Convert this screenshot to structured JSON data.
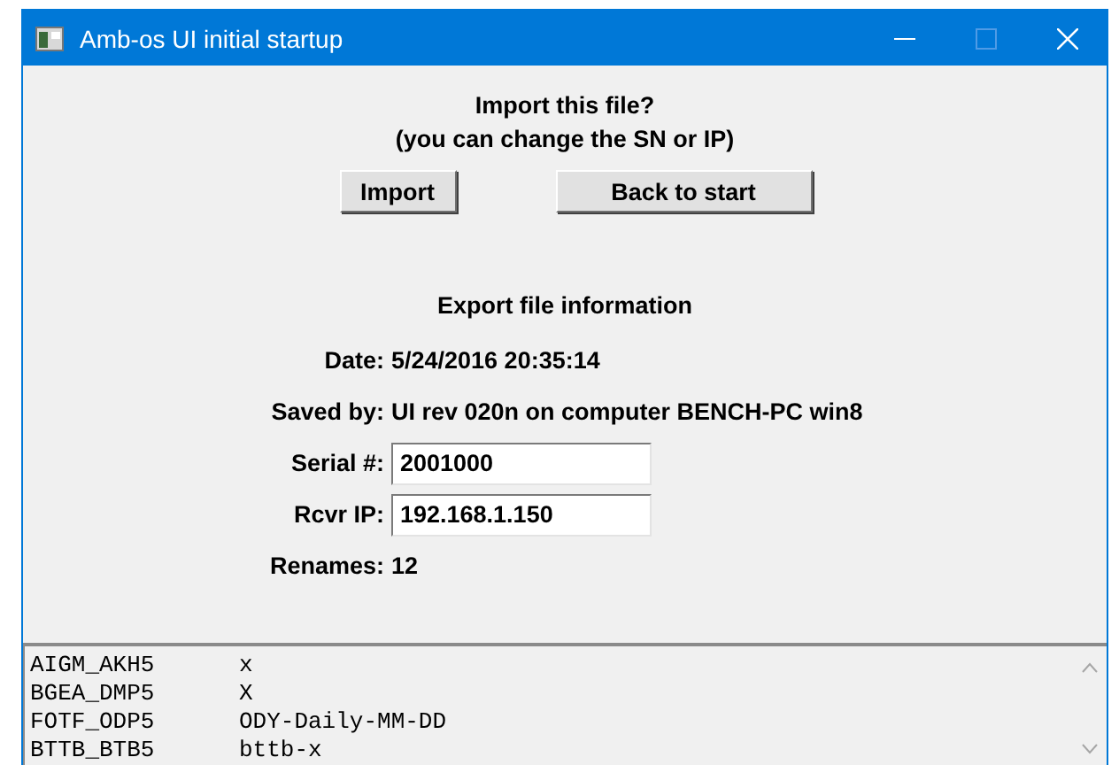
{
  "window": {
    "title": "Amb-os UI initial startup"
  },
  "prompt": [
    "Import this file?",
    "(you can change the SN or IP)"
  ],
  "buttons": [
    "Import",
    "Back to start"
  ],
  "export_info": {
    "heading": "Export file information",
    "fields": [
      {
        "kind": "text",
        "label": "Date:",
        "value": "5/24/2016 20:35:14"
      },
      {
        "kind": "text",
        "label": "Saved by:",
        "value": "UI rev 020n on computer BENCH-PC win8"
      },
      {
        "kind": "input",
        "label": "Serial #:",
        "value": "2001000"
      },
      {
        "kind": "input",
        "label": "Rcvr IP:",
        "value": "192.168.1.150"
      },
      {
        "kind": "text",
        "label": "Renames:",
        "value": "12"
      }
    ]
  },
  "renames_list": [
    {
      "from": "AIGM_AKH5",
      "to": "x"
    },
    {
      "from": "BGEA_DMP5",
      "to": "X"
    },
    {
      "from": "FOTF_ODP5",
      "to": "ODY-Daily-MM-DD"
    },
    {
      "from": "BTTB_BTB5",
      "to": "bttb-x"
    }
  ]
}
